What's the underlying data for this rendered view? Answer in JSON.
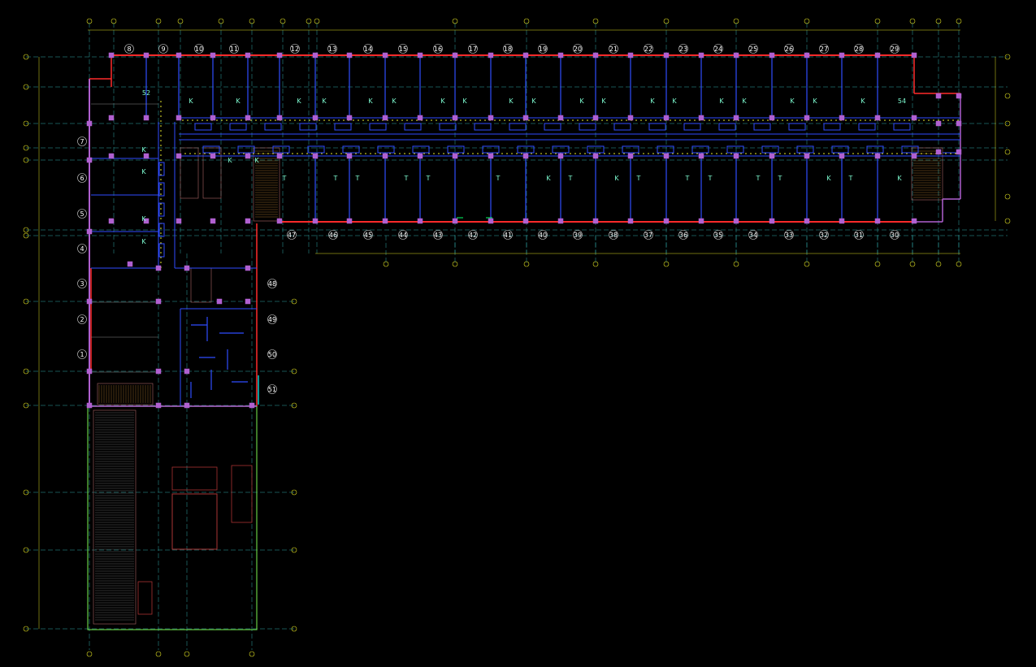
{
  "colors": {
    "background": "#000000",
    "wall_exterior": "#ff2a2a",
    "wall_interior": "#2f4dff",
    "column": "#b060d0",
    "grid_line": "#33aaaa",
    "bubble": "#dddd22",
    "corridor_marks": "#ffff33",
    "room_label": "#ffffff",
    "room_tag": "#7fffd4",
    "canopy": "#66cc44",
    "hatch": "#aa6666"
  },
  "rooms": {
    "top_row": [
      "8",
      "9",
      "10",
      "11",
      "12",
      "13",
      "14",
      "15",
      "16",
      "17",
      "18",
      "19",
      "20",
      "21",
      "22",
      "23",
      "24",
      "25",
      "26",
      "27",
      "28",
      "29"
    ],
    "bottom_row": [
      "47",
      "46",
      "45",
      "44",
      "43",
      "42",
      "41",
      "40",
      "39",
      "38",
      "37",
      "36",
      "35",
      "34",
      "33",
      "32",
      "31",
      "30"
    ],
    "left_column": [
      "7",
      "6",
      "5",
      "4",
      "3",
      "2",
      "1"
    ],
    "annex": [
      "48",
      "49",
      "50",
      "51"
    ],
    "corner_labels": [
      "52",
      "54"
    ]
  },
  "tags": {
    "upper_row": [
      "K",
      "K",
      "K",
      "K",
      "K",
      "K",
      "K",
      "K",
      "K",
      "K",
      "K",
      "K",
      "K",
      "K",
      "K",
      "K",
      "K",
      "K",
      "K",
      "K",
      "K"
    ],
    "lower_row": [
      "T",
      "T",
      "T",
      "T",
      "T",
      "T",
      "K",
      "T",
      "K",
      "T",
      "T",
      "T",
      "T",
      "T",
      "K",
      "T",
      "K"
    ],
    "wing": [
      "K",
      "K",
      "K",
      "K"
    ]
  }
}
